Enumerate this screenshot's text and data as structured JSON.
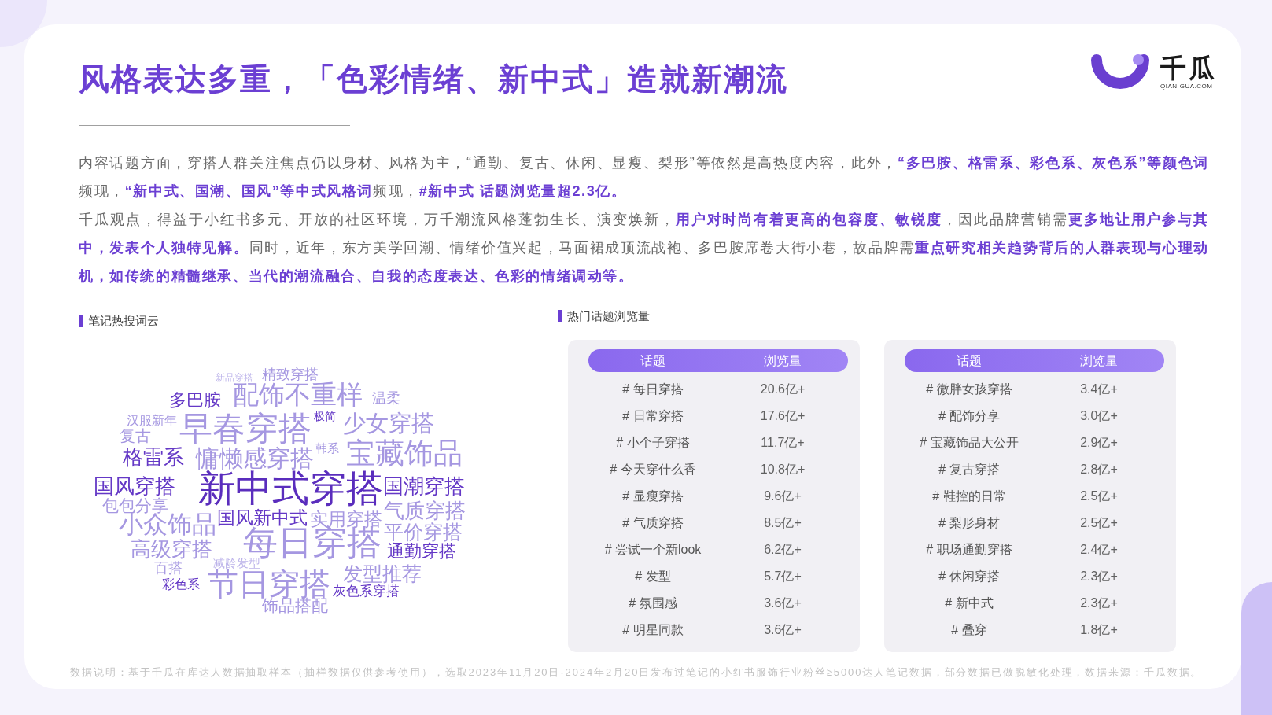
{
  "title": "风格表达多重，「色彩情绪、新中式」造就新潮流",
  "logo": {
    "name": "千瓜",
    "domain": "QIAN-GUA.COM"
  },
  "paragraphs": [
    "内容话题方面，穿搭人群关注焦点仍以身材、风格为主，“通勤、复古、休闲、显瘦、梨形”等依然是高热度内容，此外，**“多巴胺、格雷系、彩色系、灰色系”等颜色词**频现，**“新中式、国潮、国风”等中式风格词**频现，**#新中式 话题浏览量超2.3亿。**",
    "千瓜观点，得益于小红书多元、开放的社区环境，万千潮流风格蓬勃生长、演变焕新，**用户对时尚有着更高的包容度、敏锐度**，因此品牌营销需**更多地让用户参与其中，发表个人独特见解。**同时，近年，东方美学回潮、情绪价值兴起，马面裙成顶流战袍、多巴胺席卷大街小巷，故品牌需**重点研究相关趋势背后的人群表现与心理动机，如传统的精髓继承、当代的潮流融合、自我的态度表达、色彩的情绪调动等。**"
  ],
  "word_cloud": {
    "title": "笔记热搜词云",
    "words": [
      {
        "text": "新品穿搭",
        "color": "#bcb3ea"
      },
      {
        "text": "精致穿搭",
        "color": "#a597e1"
      },
      {
        "text": "多巴胺",
        "color": "#6438c6"
      },
      {
        "text": "配饰不重样",
        "color": "#a597e1"
      },
      {
        "text": "温柔",
        "color": "#a597e1"
      },
      {
        "text": "汉服新年",
        "color": "#a597e1"
      },
      {
        "text": "复古",
        "color": "#a597e1"
      },
      {
        "text": "早春穿搭",
        "color": "#a597e1"
      },
      {
        "text": "极简",
        "color": "#6438c6"
      },
      {
        "text": "少女穿搭",
        "color": "#a597e1"
      },
      {
        "text": "格雷系",
        "color": "#6438c6"
      },
      {
        "text": "慵懒感穿搭",
        "color": "#a597e1"
      },
      {
        "text": "韩系",
        "color": "#a597e1"
      },
      {
        "text": "宝藏饰品",
        "color": "#a597e1"
      },
      {
        "text": "国风穿搭",
        "color": "#6438c6"
      },
      {
        "text": "新中式穿搭",
        "color": "#5a2dbd"
      },
      {
        "text": "国潮穿搭",
        "color": "#6438c6"
      },
      {
        "text": "包包分享",
        "color": "#a597e1"
      },
      {
        "text": "气质穿搭",
        "color": "#a597e1"
      },
      {
        "text": "小众饰品",
        "color": "#a597e1"
      },
      {
        "text": "国风新中式",
        "color": "#6438c6"
      },
      {
        "text": "实用穿搭",
        "color": "#a597e1"
      },
      {
        "text": "高级穿搭",
        "color": "#a597e1"
      },
      {
        "text": "每日穿搭",
        "color": "#a597e1"
      },
      {
        "text": "平价穿搭",
        "color": "#a597e1"
      },
      {
        "text": "通勤穿搭",
        "color": "#6438c6"
      },
      {
        "text": "百搭",
        "color": "#a597e1"
      },
      {
        "text": "减龄发型",
        "color": "#bcb3ea"
      },
      {
        "text": "彩色系",
        "color": "#6438c6"
      },
      {
        "text": "节日穿搭",
        "color": "#a597e1"
      },
      {
        "text": "发型推荐",
        "color": "#a597e1"
      },
      {
        "text": "灰色系穿搭",
        "color": "#6438c6"
      },
      {
        "text": "饰品搭配",
        "color": "#a597e1"
      }
    ]
  },
  "hot_topics": {
    "title": "热门话题浏览量",
    "tables": [
      {
        "columns": [
          "话题",
          "浏览量"
        ],
        "rows": [
          {
            "topic": "# 每日穿搭",
            "views": "20.6亿+"
          },
          {
            "topic": "# 日常穿搭",
            "views": "17.6亿+"
          },
          {
            "topic": "# 小个子穿搭",
            "views": "11.7亿+"
          },
          {
            "topic": "# 今天穿什么香",
            "views": "10.8亿+"
          },
          {
            "topic": "# 显瘦穿搭",
            "views": "9.6亿+"
          },
          {
            "topic": "# 气质穿搭",
            "views": "8.5亿+"
          },
          {
            "topic": "# 尝试一个新look",
            "views": "6.2亿+"
          },
          {
            "topic": "# 发型",
            "views": "5.7亿+"
          },
          {
            "topic": "# 氛围感",
            "views": "3.6亿+"
          },
          {
            "topic": "# 明星同款",
            "views": "3.6亿+"
          }
        ]
      },
      {
        "columns": [
          "话题",
          "浏览量"
        ],
        "rows": [
          {
            "topic": "# 微胖女孩穿搭",
            "views": "3.4亿+"
          },
          {
            "topic": "# 配饰分享",
            "views": "3.0亿+"
          },
          {
            "topic": "# 宝藏饰品大公开",
            "views": "2.9亿+"
          },
          {
            "topic": "# 复古穿搭",
            "views": "2.8亿+"
          },
          {
            "topic": "# 鞋控的日常",
            "views": "2.5亿+"
          },
          {
            "topic": "# 梨形身材",
            "views": "2.5亿+"
          },
          {
            "topic": "# 职场通勤穿搭",
            "views": "2.4亿+"
          },
          {
            "topic": "# 休闲穿搭",
            "views": "2.3亿+"
          },
          {
            "topic": "# 新中式",
            "views": "2.3亿+"
          },
          {
            "topic": "# 叠穿",
            "views": "1.8亿+"
          }
        ]
      }
    ]
  },
  "footnote": "数据说明：基于千瓜在库达人数据抽取样本（抽样数据仅供参考使用），选取2023年11月20日-2024年2月20日发布过笔记的小红书服饰行业粉丝≥5000达人笔记数据，部分数据已做脱敏化处理，数据来源：千瓜数据。"
}
